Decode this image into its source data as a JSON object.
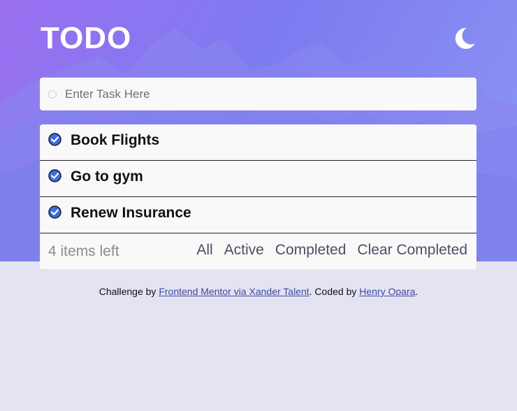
{
  "header": {
    "title": "TODO",
    "theme_icon": "moon-icon"
  },
  "new_task": {
    "placeholder": "Enter Task Here",
    "value": ""
  },
  "tasks": [
    {
      "label": "Book Flights",
      "checked": true
    },
    {
      "label": "Go to gym",
      "checked": true
    },
    {
      "label": "Renew Insurance",
      "checked": true
    }
  ],
  "footer": {
    "items_left": "4 items left",
    "filters": {
      "all": "All",
      "active": "Active",
      "completed": "Completed",
      "clear": "Clear Completed"
    }
  },
  "attribution": {
    "prefix": "Challenge by ",
    "challenge_link": "Frontend Mentor via Xander Talent",
    "middle": ". Coded by ",
    "author_link": "Henry Opara",
    "suffix": "."
  },
  "colors": {
    "hero_gradient_start": "#9a6ff0",
    "hero_gradient_end": "#8d97f4",
    "page_background": "#e4e3f1",
    "card_background": "#f9f9f9",
    "check_blue": "#3b6fe0",
    "link": "#3d4aa0"
  }
}
